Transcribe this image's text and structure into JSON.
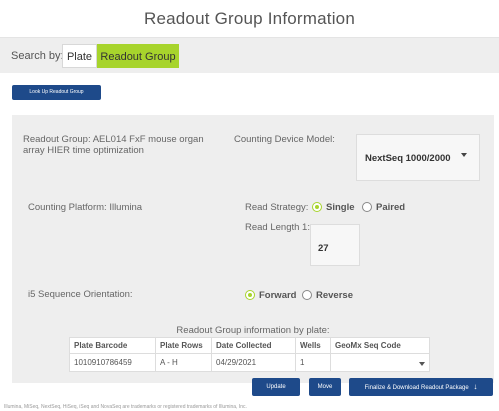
{
  "page": {
    "title": "Readout Group Information"
  },
  "search": {
    "label": "Search by:",
    "options": [
      "Plate",
      "Readout Group"
    ],
    "selected": "Readout Group",
    "accent": "#a7d42c"
  },
  "lookup_button": "Look Up Readout Group",
  "readout_group": "Readout Group: AEL014 FxF mouse organ array HIER time optimization",
  "counting_device": {
    "label": "Counting Device Model:",
    "value": "NextSeq 1000/2000"
  },
  "counting_platform": "Counting Platform: Illumina",
  "read_strategy": {
    "label": "Read Strategy:",
    "options": [
      "Single",
      "Paired"
    ],
    "selected": "Single"
  },
  "read_length": {
    "label": "Read Length 1:",
    "value": "27"
  },
  "i5": {
    "label": "i5 Sequence Orientation:",
    "options": [
      "Forward",
      "Reverse"
    ],
    "selected": "Forward"
  },
  "plates_table": {
    "title": "Readout Group information by plate:",
    "headers": [
      "Plate Barcode",
      "Plate Rows",
      "Date Collected",
      "Wells",
      "GeoMx Seq Code"
    ],
    "rows": [
      [
        "1010910786459",
        "A - H",
        "04/29/2021",
        "1",
        ""
      ]
    ]
  },
  "buttons": {
    "update": "Update",
    "move": "Move",
    "finalize": "Finalize & Download Readout Package"
  },
  "footer": "Illumina, MiSeq, NextSeq, HiSeq, iSeq and NovaSeq are trademarks or registered trademarks of Illumina, Inc.",
  "colors": {
    "primary_button": "#1e4a8a",
    "accent": "#a7d42c",
    "panel": "#eeeeee"
  }
}
